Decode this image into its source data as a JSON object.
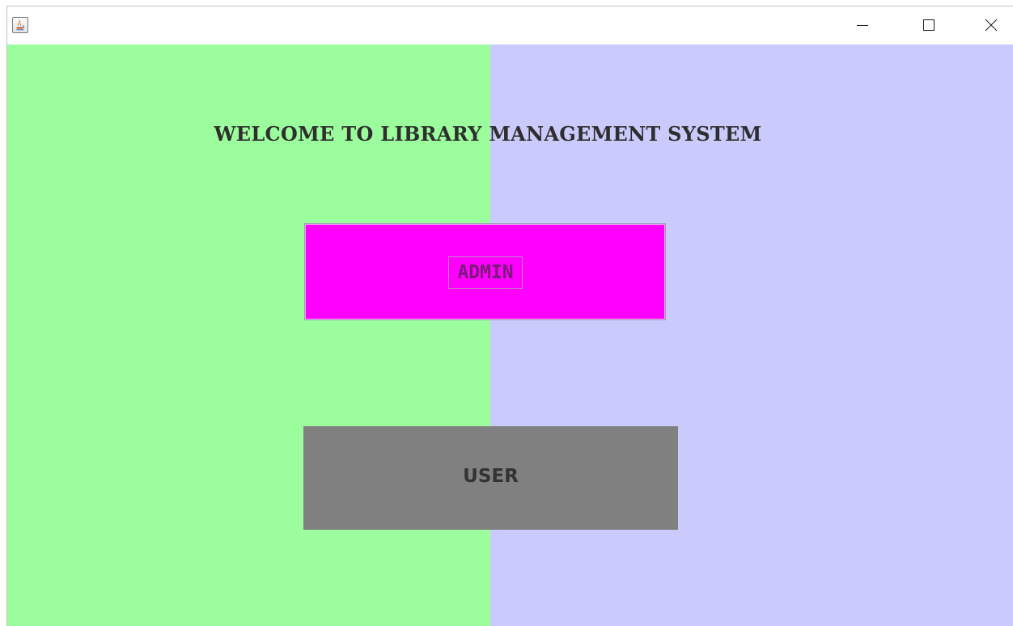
{
  "window": {
    "icon": "java-icon",
    "controls": {
      "minimize_icon": "minimize-icon",
      "maximize_icon": "maximize-icon",
      "close_icon": "close-icon"
    }
  },
  "main": {
    "heading": "WELCOME TO LIBRARY MANAGEMENT SYSTEM",
    "admin_button_label": "ADMIN",
    "user_button_label": "USER"
  },
  "colors": {
    "left_panel": "#9cfd9c",
    "right_panel": "#cacafc",
    "admin_button": "#ff00ff",
    "user_button": "#808080"
  }
}
